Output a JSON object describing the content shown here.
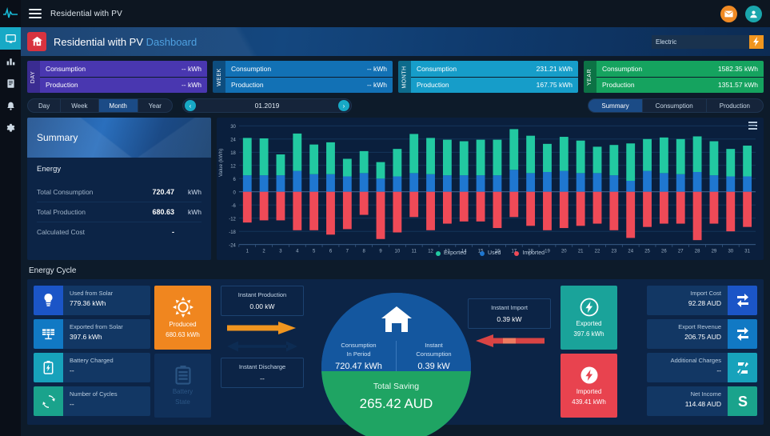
{
  "rail": {
    "logo_icon": "pulse-logo-icon",
    "items": [
      {
        "name": "dashboard",
        "icon": "monitor-icon",
        "active": true
      },
      {
        "name": "analytics",
        "icon": "bar-chart-icon",
        "active": false
      },
      {
        "name": "reports",
        "icon": "document-icon",
        "active": false
      },
      {
        "name": "notifications",
        "icon": "bell-icon",
        "active": false
      },
      {
        "name": "settings",
        "icon": "gear-icon",
        "active": false
      }
    ]
  },
  "topbar": {
    "menu_icon": "hamburger-icon",
    "title": "Residential with PV",
    "mail_icon": "mail-icon",
    "user_icon": "user-avatar-icon"
  },
  "header": {
    "home_icon": "home-icon",
    "title": "Residential with PV",
    "subtitle": "Dashboard",
    "electric_value": "Electric",
    "electric_placeholder": "Electric",
    "bolt_icon": "lightning-bolt-icon"
  },
  "periods": [
    {
      "tab": "DAY",
      "consumption_label": "Consumption",
      "consumption_value": "-- kWh",
      "production_label": "Production",
      "production_value": "-- kWh"
    },
    {
      "tab": "WEEK",
      "consumption_label": "Consumption",
      "consumption_value": "-- kWh",
      "production_label": "Production",
      "production_value": "-- kWh"
    },
    {
      "tab": "MONTH",
      "consumption_label": "Consumption",
      "consumption_value": "231.21 kWh",
      "production_label": "Production",
      "production_value": "167.75 kWh"
    },
    {
      "tab": "YEAR",
      "consumption_label": "Consumption",
      "consumption_value": "1582.35 kWh",
      "production_label": "Production",
      "production_value": "1351.57 kWh"
    }
  ],
  "range_tabs": [
    {
      "label": "Day",
      "active": false
    },
    {
      "label": "Week",
      "active": false
    },
    {
      "label": "Month",
      "active": true
    },
    {
      "label": "Year",
      "active": false
    }
  ],
  "date_nav": {
    "prev_icon": "chevron-left-icon",
    "label": "01.2019",
    "next_icon": "chevron-right-icon"
  },
  "view_tabs": [
    {
      "label": "Summary",
      "active": true
    },
    {
      "label": "Consumption",
      "active": false
    },
    {
      "label": "Production",
      "active": false
    }
  ],
  "summary": {
    "title": "Summary",
    "section": "Energy",
    "rows": [
      {
        "label": "Total Consumption",
        "value": "720.47",
        "unit": "kWh"
      },
      {
        "label": "Total Production",
        "value": "680.63",
        "unit": "kWh"
      },
      {
        "label": "Calculated Cost",
        "value": "-",
        "unit": ""
      }
    ]
  },
  "chart_data": {
    "type": "bar",
    "title": "",
    "xlabel": "",
    "ylabel": "Value (kWh)",
    "ylim": [
      -24,
      30
    ],
    "yticks": [
      30,
      24,
      18,
      12,
      6,
      0,
      -6,
      -12,
      -18,
      -24
    ],
    "grid": true,
    "legend_position": "bottom",
    "stacked": true,
    "categories": [
      "1",
      "2",
      "3",
      "4",
      "5",
      "6",
      "7",
      "8",
      "9",
      "10",
      "11",
      "12",
      "13",
      "14",
      "15",
      "16",
      "17",
      "18",
      "19",
      "20",
      "21",
      "22",
      "23",
      "24",
      "25",
      "26",
      "27",
      "28",
      "29",
      "30",
      "31"
    ],
    "series": [
      {
        "name": "Exported",
        "color": "#22c9a1",
        "values": [
          17.0,
          16.8,
          9.5,
          17.0,
          13.5,
          14.5,
          8.0,
          10.0,
          7.5,
          12.5,
          17.8,
          16.5,
          16.2,
          15.5,
          16.2,
          16.2,
          18.5,
          17.0,
          12.8,
          15.5,
          14.8,
          12.0,
          13.8,
          17.0,
          14.5,
          16.2,
          16.0,
          16.2,
          15.5,
          12.5,
          14.0
        ]
      },
      {
        "name": "Used",
        "color": "#1f77d0",
        "values": [
          7.5,
          7.5,
          7.5,
          9.5,
          8.0,
          8.0,
          7.0,
          8.5,
          6.0,
          7.0,
          8.5,
          8.0,
          7.5,
          7.5,
          7.5,
          7.5,
          10.0,
          8.5,
          9.0,
          9.5,
          8.5,
          8.5,
          7.5,
          5.0,
          9.5,
          8.5,
          8.0,
          9.0,
          7.5,
          7.0,
          7.0
        ]
      },
      {
        "name": "Imported",
        "color": "#ef4a57",
        "values": [
          -14.0,
          -13.0,
          -13.0,
          -17.5,
          -17.5,
          -19.5,
          -17.0,
          -10.5,
          -21.5,
          -18.5,
          -11.5,
          -17.5,
          -14.5,
          -13.5,
          -13.5,
          -16.5,
          -11.5,
          -15.5,
          -17.5,
          -16.5,
          -15.5,
          -14.5,
          -17.5,
          -21.0,
          -16.0,
          -14.5,
          -14.5,
          -22.0,
          -14.5,
          -18.0,
          -16.0
        ]
      }
    ]
  },
  "cycle": {
    "title": "Energy Cycle",
    "left_tiles": [
      {
        "label": "Used from Solar",
        "value": "779.36 kWh",
        "icon": "lightbulb-icon",
        "icon_bg": "#1b55c7"
      },
      {
        "label": "Exported from Solar",
        "value": "397.6 kWh",
        "icon": "solar-panel-icon",
        "icon_bg": "#1179c4"
      },
      {
        "label": "Battery Charged",
        "value": "--",
        "icon": "battery-charge-icon",
        "icon_bg": "#17a2bb"
      },
      {
        "label": "Number of Cycles",
        "value": "--",
        "icon": "cycles-icon",
        "icon_bg": "#1aa38c"
      }
    ],
    "produced": {
      "label": "Produced",
      "value": "680.63 kWh",
      "icon": "sun-icon"
    },
    "battery": {
      "label": "Battery",
      "value": "State",
      "icon": "battery-icon"
    },
    "instant_production": {
      "label": "Instant Production",
      "value": "0.00 kW"
    },
    "instant_discharge": {
      "label": "Instant Discharge",
      "value": "--"
    },
    "instant_import": {
      "label": "Instant Import",
      "value": "0.39 kW"
    },
    "center": {
      "home_icon": "home-icon",
      "consumption_label": "Consumption\nIn Period",
      "consumption_label_l1": "Consumption",
      "consumption_label_l2": "In Period",
      "consumption_value": "720.47 kWh",
      "instant_label_l1": "Instant",
      "instant_label_l2": "Consumption",
      "instant_value": "0.39 kW",
      "saving_label": "Total Saving",
      "saving_value": "265.42 AUD"
    },
    "exported": {
      "label": "Exported",
      "value": "397.6 kWh",
      "icon": "bolt-circle-icon"
    },
    "imported": {
      "label": "Imported",
      "value": "439.41 kWh",
      "icon": "bolt-circle-icon"
    },
    "money": [
      {
        "label": "Import Cost",
        "value": "92.28 AUD",
        "icon": "currency-exchange-icon",
        "icon_bg": "#1b55c7"
      },
      {
        "label": "Export Revenue",
        "value": "206.75 AUD",
        "icon": "currency-exchange-icon",
        "icon_bg": "#1179c4"
      },
      {
        "label": "Additional Charges",
        "value": "--",
        "icon": "currency-slash-icon",
        "icon_bg": "#17a2bb"
      },
      {
        "label": "Net Income",
        "value": "114.48 AUD",
        "icon": "currency-icon",
        "icon_bg": "#1aa38c"
      }
    ]
  }
}
